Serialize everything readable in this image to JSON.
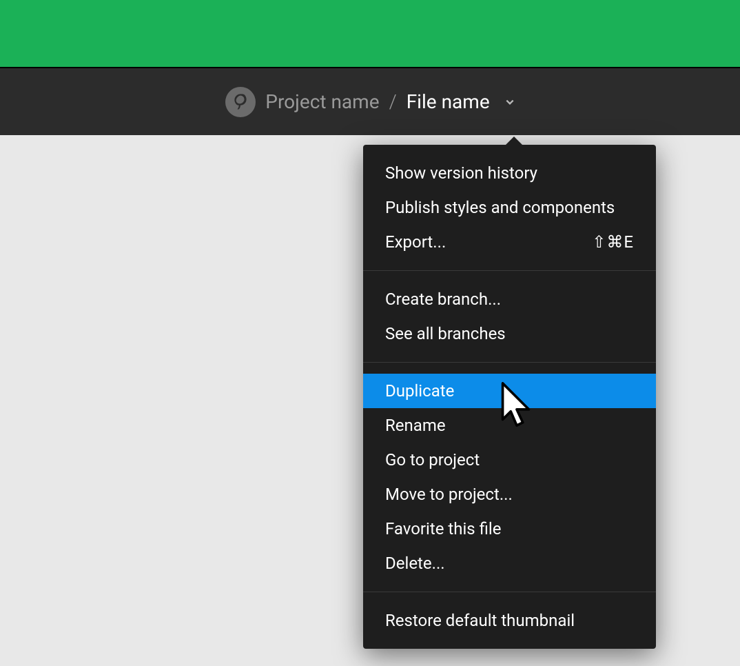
{
  "colors": {
    "banner": "#1bb157",
    "toolbar": "#2c2c2c",
    "background": "#e8e8e8",
    "dropdown": "#1e1e1e",
    "highlight": "#0c8ce9"
  },
  "breadcrumb": {
    "project_name": "Project name",
    "separator": "/",
    "file_name": "File name"
  },
  "menu": {
    "group1": {
      "show_version_history": "Show version history",
      "publish_styles": "Publish styles and components",
      "export": {
        "label": "Export...",
        "shortcut": "⇧⌘E"
      }
    },
    "group2": {
      "create_branch": "Create branch...",
      "see_all_branches": "See all branches"
    },
    "group3": {
      "duplicate": "Duplicate",
      "rename": "Rename",
      "go_to_project": "Go to project",
      "move_to_project": "Move to project...",
      "favorite": "Favorite this file",
      "delete": "Delete..."
    },
    "group4": {
      "restore_thumbnail": "Restore default thumbnail"
    }
  }
}
